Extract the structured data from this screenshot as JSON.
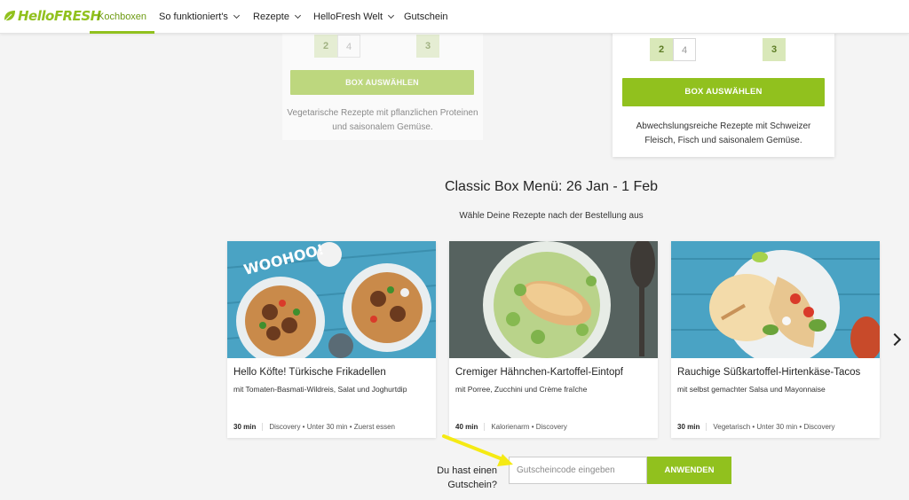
{
  "brand": {
    "logo_text": "HelloFRESH",
    "color": "#91c11e"
  },
  "nav": {
    "items": [
      {
        "label": "Kochboxen",
        "active": true
      },
      {
        "label": "So funktioniert's",
        "dropdown": true
      },
      {
        "label": "Rezepte",
        "dropdown": true
      },
      {
        "label": "HelloFresh Welt",
        "dropdown": true
      },
      {
        "label": "Gutschein"
      }
    ]
  },
  "plans": [
    {
      "counts": [
        "2",
        "4"
      ],
      "recipes": "3",
      "selected_count": "2",
      "button": "BOX AUSWÄHLEN",
      "description": "Vegetarische Rezepte mit pflanzlichen Proteinen und saisonalem Gemüse."
    },
    {
      "counts": [
        "2",
        "4"
      ],
      "recipes": "3",
      "selected_count": "2",
      "button": "BOX AUSWÄHLEN",
      "description": "Abwechslungsreiche Rezepte mit Schweizer Fleisch, Fisch und saisonalem Gemüse."
    }
  ],
  "menu": {
    "title": "Classic Box Menü: 26 Jan - 1 Feb",
    "subtitle": "Wähle Deine Rezepte nach der Bestellung aus"
  },
  "recipes": [
    {
      "title": "Hello Köfte! Türkische Frikadellen",
      "subtitle": "mit Tomaten-Basmati-Wildreis, Salat und Joghurtdip",
      "time": "30 min",
      "tags": "Discovery • Unter 30 min • Zuerst essen",
      "image_text": "WOOHOO!"
    },
    {
      "title": "Cremiger Hähnchen-Kartoffel-Eintopf",
      "subtitle": "mit Porree, Zucchini und Crème fraîche",
      "time": "40 min",
      "tags": "Kalorienarm • Discovery"
    },
    {
      "title": "Rauchige Süßkartoffel-Hirtenkäse-Tacos",
      "subtitle": "mit selbst gemachter Salsa und Mayonnaise",
      "time": "30 min",
      "tags": "Vegetarisch • Unter 30 min • Discovery"
    }
  ],
  "voucher": {
    "label": "Du hast einen Gutschein?",
    "placeholder": "Gutscheincode eingeben",
    "value": "",
    "button": "ANWENDEN"
  },
  "colors": {
    "accent": "#91c11e",
    "annotation_arrow": "#f5ea14"
  }
}
